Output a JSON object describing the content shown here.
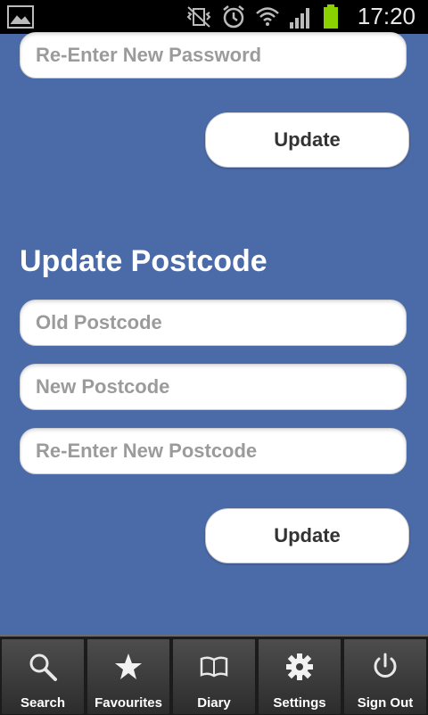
{
  "status_bar": {
    "time": "17:20"
  },
  "password_section": {
    "reenter_placeholder": "Re-Enter New Password",
    "update_label": "Update"
  },
  "postcode_section": {
    "title": "Update Postcode",
    "old_placeholder": "Old Postcode",
    "new_placeholder": "New Postcode",
    "reenter_placeholder": "Re-Enter New Postcode",
    "update_label": "Update"
  },
  "nav": {
    "items": [
      {
        "label": "Search",
        "icon": "search-icon"
      },
      {
        "label": "Favourites",
        "icon": "star-icon"
      },
      {
        "label": "Diary",
        "icon": "book-icon"
      },
      {
        "label": "Settings",
        "icon": "gear-icon"
      },
      {
        "label": "Sign Out",
        "icon": "power-icon"
      }
    ]
  },
  "colors": {
    "background": "#4a6aa8",
    "battery": "#8bd100"
  }
}
